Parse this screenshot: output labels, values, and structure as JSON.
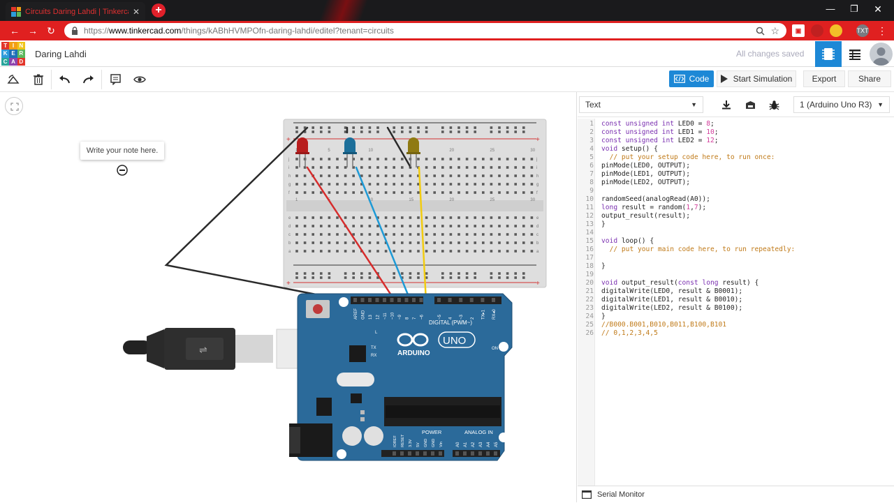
{
  "browser": {
    "tab_title": "Circuits Daring Lahdi | Tinkercad",
    "url_scheme": "https://",
    "url_host": "www.tinkercad.com",
    "url_path": "/things/kABhHVMPOfn-daring-lahdi/editel?tenant=circuits",
    "ext_label": "TXT"
  },
  "app": {
    "logo_letters": [
      "T",
      "I",
      "N",
      "K",
      "E",
      "R",
      "C",
      "A",
      "D"
    ],
    "logo_colors": [
      "#e2352a",
      "#f2a015",
      "#f0c419",
      "#2d9cdb",
      "#1e6fb8",
      "#5cb85c",
      "#2aa59c",
      "#8e44ad",
      "#e2352a"
    ],
    "design_name": "Daring Lahdi",
    "save_status": "All changes saved",
    "accent": "#1d88d6"
  },
  "toolbar": {
    "code_label": "Code",
    "simulate_label": "Start Simulation",
    "export_label": "Export",
    "share_label": "Share"
  },
  "canvas": {
    "note_text": "Write your note here."
  },
  "breadboard": {
    "column_numbers": [
      "1",
      "",
      "",
      "",
      "5",
      "",
      "",
      "",
      "",
      "10",
      "",
      "",
      "",
      "",
      "15",
      "",
      "",
      "",
      "",
      "20",
      "",
      "",
      "",
      "",
      "25",
      "",
      "",
      "",
      "",
      "30"
    ],
    "row_letters_top": [
      "j",
      "i",
      "h",
      "g",
      "f"
    ],
    "row_letters_bottom": [
      "e",
      "d",
      "c",
      "b",
      "a"
    ]
  },
  "arduino": {
    "brand": "ARDUINO",
    "model": "UNO",
    "digital_label": "DIGITAL (PWM~)",
    "power_label": "POWER",
    "analog_label": "ANALOG IN",
    "on_label": "ON",
    "tx_label": "TX",
    "rx_label": "RX",
    "l_label": "L",
    "digital_pins": [
      "AREF",
      "GND",
      "13",
      "12",
      "~11",
      "~10",
      "~9",
      "8",
      "7",
      "~6",
      "~5",
      "4",
      "~3",
      "2",
      "TX▸1",
      "RX◂0"
    ],
    "power_pins": [
      "IOREF",
      "RESET",
      "3.3V",
      "5V",
      "GND",
      "GND",
      "Vin"
    ],
    "analog_pins": [
      "A0",
      "A1",
      "A2",
      "A3",
      "A4",
      "A5"
    ]
  },
  "panel": {
    "mode": "Text",
    "device": "1 (Arduino Uno R3)",
    "serial_monitor_label": "Serial Monitor",
    "line_numbers": [
      "1",
      "2",
      "3",
      "4",
      "5",
      "6",
      "7",
      "8",
      "9",
      "10",
      "11",
      "12",
      "13",
      "14",
      "15",
      "16",
      "17",
      "18",
      "19",
      "20",
      "21",
      "22",
      "23",
      "24",
      "25",
      "26"
    ],
    "code_lines": [
      "const unsigned int LED0 = 8;",
      "const unsigned int LED1 = 10;",
      "const unsigned int LED2 = 12;",
      "void setup() {",
      "  // put your setup code here, to run once:",
      "pinMode(LED0, OUTPUT);",
      "pinMode(LED1, OUTPUT);",
      "pinMode(LED2, OUTPUT);",
      "",
      "randomSeed(analogRead(A0));",
      "long result = random(1,7);",
      "output_result(result);",
      "}",
      "",
      "void loop() {",
      "  // put your main code here, to run repeatedly:",
      "",
      "}",
      "",
      "void output_result(const long result) {",
      "digitalWrite(LED0, result & B0001);",
      "digitalWrite(LED1, result & B0010);",
      "digitalWrite(LED2, result & B0100);",
      "}",
      "//B000.B001,B010,B011,B100,B101",
      "// 0,1,2,3,4,5"
    ]
  }
}
